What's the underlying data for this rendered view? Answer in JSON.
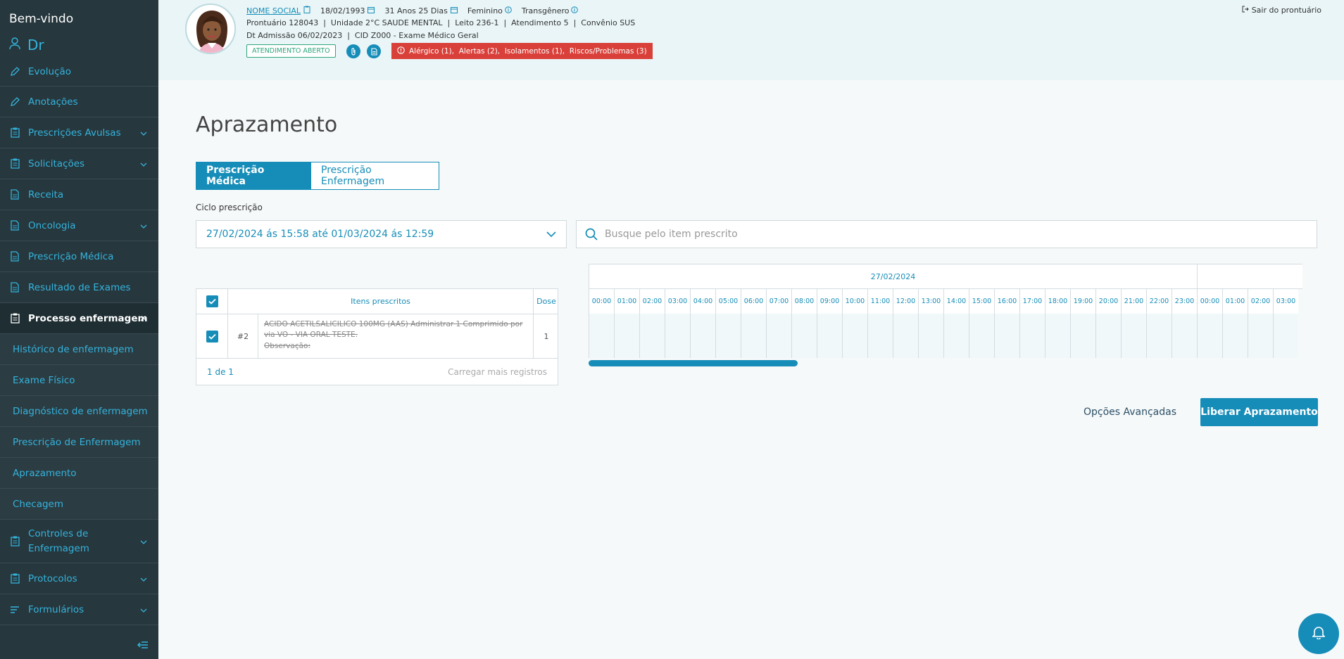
{
  "sidebar": {
    "welcome": "Bem-vindo",
    "user": "Dr",
    "items": [
      {
        "label": "Evolução"
      },
      {
        "label": "Anotações"
      },
      {
        "label": "Prescrições Avulsas"
      },
      {
        "label": "Solicitações"
      },
      {
        "label": "Receita"
      },
      {
        "label": "Oncologia"
      },
      {
        "label": "Prescrição Médica"
      },
      {
        "label": "Resultado de Exames"
      },
      {
        "label": "Processo enfermagem"
      },
      {
        "label": "Controles de Enfermagem"
      },
      {
        "label": "Protocolos"
      },
      {
        "label": "Formulários"
      }
    ],
    "sub_items": [
      {
        "label": "Histórico de enfermagem"
      },
      {
        "label": "Exame Físico"
      },
      {
        "label": "Diagnóstico de enfermagem"
      },
      {
        "label": "Prescrição de Enfermagem"
      },
      {
        "label": "Aprazamento"
      },
      {
        "label": "Checagem"
      }
    ]
  },
  "header": {
    "social_name": "NOME SOCIAL",
    "birth": "18/02/1993",
    "age": "31 Anos 25 Dias",
    "sex": "Feminino",
    "gender": "Transgênero",
    "line2": "Prontuário 128043  |  Unidade 2°C SAUDE MENTAL  |  Leito 236-1  |  Atendimento 5  |  Convênio SUS",
    "line3": "Dt Admissão 06/02/2023  |  CID Z000 - Exame Médico Geral",
    "status": "ATENDIMENTO ABERTO",
    "alerts": "Alérgico (1),  Alertas (2),  Isolamentos (1),  Riscos/Problemas (3)",
    "exit": "Sair do prontuário"
  },
  "main": {
    "title": "Aprazamento",
    "tabs": [
      {
        "label": "Prescrição Médica"
      },
      {
        "label": "Prescrição Enfermagem"
      }
    ],
    "cycle_label": "Ciclo prescrição",
    "cycle_value": "27/02/2024 ás 15:58 até 01/03/2024 ás 12:59",
    "search_placeholder": "Busque pelo item prescrito"
  },
  "table": {
    "col_items": "Itens prescritos",
    "col_dose": "Dose",
    "row": {
      "num": "#2",
      "desc": "ACIDO ACETILSALICILICO 100MG (AAS) Administrar 1 Comprimido por via VO - VIA ORAL TESTE.",
      "obs": "Observação:",
      "dose": "1"
    },
    "pagination": "1 de 1",
    "load_more": "Carregar mais registros"
  },
  "timeline": {
    "date": "27/02/2024",
    "hours": [
      "00:00",
      "01:00",
      "02:00",
      "03:00",
      "04:00",
      "05:00",
      "06:00",
      "07:00",
      "08:00",
      "09:00",
      "10:00",
      "11:00",
      "12:00",
      "13:00",
      "14:00",
      "15:00",
      "16:00",
      "17:00",
      "18:00",
      "19:00",
      "20:00",
      "21:00",
      "22:00",
      "23:00",
      "00:00",
      "01:00",
      "02:00",
      "03:00"
    ]
  },
  "actions": {
    "advanced": "Opções Avançadas",
    "release": "Liberar Aprazamento"
  }
}
